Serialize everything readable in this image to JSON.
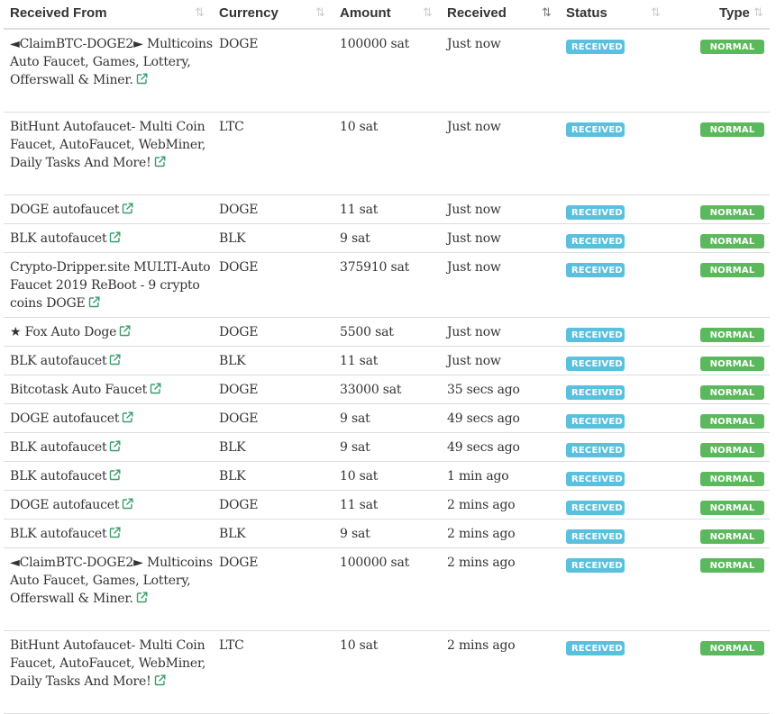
{
  "columns": {
    "from": "Received From",
    "currency": "Currency",
    "amount": "Amount",
    "received": "Received",
    "status": "Status",
    "type": "Type"
  },
  "icons": {
    "sort": "sort-icon",
    "sort_active": "sort-desc-icon",
    "external": "external-link-icon"
  },
  "colors": {
    "received_badge": "#5bc0de",
    "normal_badge": "#5cb85c",
    "link_icon": "#3a9d6b"
  },
  "rows": [
    {
      "from": "◄ClaimBTC-DOGE2► Multicoins Auto Faucet, Games, Lottery, Offerswall & Miner.",
      "currency": "DOGE",
      "amount": "100000 sat",
      "received": "Just now",
      "status": "RECEIVED",
      "type": "NORMAL"
    },
    {
      "from": "BitHunt Autofaucet- Multi Coin Faucet, AutoFaucet, WebMiner, Daily Tasks And More!",
      "currency": "LTC",
      "amount": "10 sat",
      "received": "Just now",
      "status": "RECEIVED",
      "type": "NORMAL"
    },
    {
      "from": "DOGE autofaucet",
      "currency": "DOGE",
      "amount": "11 sat",
      "received": "Just now",
      "status": "RECEIVED",
      "type": "NORMAL"
    },
    {
      "from": "BLK autofaucet",
      "currency": "BLK",
      "amount": "9 sat",
      "received": "Just now",
      "status": "RECEIVED",
      "type": "NORMAL"
    },
    {
      "from": "Crypto-Dripper.site MULTI-Auto Faucet 2019 ReBoot - 9 crypto coins DOGE",
      "currency": "DOGE",
      "amount": "375910 sat",
      "received": "Just now",
      "status": "RECEIVED",
      "type": "NORMAL"
    },
    {
      "from": "★ Fox Auto Doge",
      "currency": "DOGE",
      "amount": "5500 sat",
      "received": "Just now",
      "status": "RECEIVED",
      "type": "NORMAL"
    },
    {
      "from": "BLK autofaucet",
      "currency": "BLK",
      "amount": "11 sat",
      "received": "Just now",
      "status": "RECEIVED",
      "type": "NORMAL"
    },
    {
      "from": "Bitcotask Auto Faucet",
      "currency": "DOGE",
      "amount": "33000 sat",
      "received": "35 secs ago",
      "status": "RECEIVED",
      "type": "NORMAL"
    },
    {
      "from": "DOGE autofaucet",
      "currency": "DOGE",
      "amount": "9 sat",
      "received": "49 secs ago",
      "status": "RECEIVED",
      "type": "NORMAL"
    },
    {
      "from": "BLK autofaucet",
      "currency": "BLK",
      "amount": "9 sat",
      "received": "49 secs ago",
      "status": "RECEIVED",
      "type": "NORMAL"
    },
    {
      "from": "BLK autofaucet",
      "currency": "BLK",
      "amount": "10 sat",
      "received": "1 min ago",
      "status": "RECEIVED",
      "type": "NORMAL"
    },
    {
      "from": "DOGE autofaucet",
      "currency": "DOGE",
      "amount": "11 sat",
      "received": "2 mins ago",
      "status": "RECEIVED",
      "type": "NORMAL"
    },
    {
      "from": "BLK autofaucet",
      "currency": "BLK",
      "amount": "9 sat",
      "received": "2 mins ago",
      "status": "RECEIVED",
      "type": "NORMAL"
    },
    {
      "from": "◄ClaimBTC-DOGE2► Multicoins Auto Faucet, Games, Lottery, Offerswall & Miner.",
      "currency": "DOGE",
      "amount": "100000 sat",
      "received": "2 mins ago",
      "status": "RECEIVED",
      "type": "NORMAL"
    },
    {
      "from": "BitHunt Autofaucet- Multi Coin Faucet, AutoFaucet, WebMiner, Daily Tasks And More!",
      "currency": "LTC",
      "amount": "10 sat",
      "received": "2 mins ago",
      "status": "RECEIVED",
      "type": "NORMAL"
    }
  ]
}
